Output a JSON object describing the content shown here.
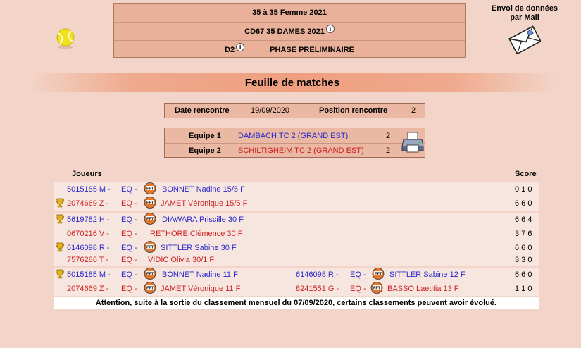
{
  "header": {
    "line1": "35  à 35  Femme  2021",
    "line2": "CD67 35 DAMES 2021",
    "line3_division": "D2",
    "line3_phase": "PHASE PRELIMINAIRE"
  },
  "mail": {
    "line1": "Envoi de données",
    "line2": "par Mail",
    "icon": "envelope-icon"
  },
  "section_title": "Feuille de matches",
  "rencontre": {
    "date_label": "Date rencontre",
    "date_value": "19/09/2020",
    "position_label": "Position rencontre",
    "position_value": "2"
  },
  "teams": [
    {
      "label": "Equipe 1",
      "name": "DAMBACH TC 2 (GRAND EST)",
      "score": "2"
    },
    {
      "label": "Equipe 2",
      "name": "SCHILTIGHEIM TC 2 (GRAND EST)",
      "score": "2"
    }
  ],
  "table": {
    "players_header": "Joueurs",
    "score_header": "Score"
  },
  "matches": [
    {
      "rows": [
        {
          "id": "5015185 M -",
          "eq": "EQ -",
          "fft": true,
          "name": "BONNET  Nadine  15/5 F",
          "score": "0 1 0",
          "trophy": false
        },
        {
          "id": "2074669 Z -",
          "eq": "EQ -",
          "fft": true,
          "name": "JAMET  Véronique  15/5 F",
          "score": "6 6 0",
          "trophy": true
        }
      ]
    },
    {
      "rows": [
        {
          "id": "5619782 H -",
          "eq": "EQ -",
          "fft": true,
          "name": "DIAWARA  Priscille  30 F",
          "score": "6 6 4",
          "trophy": true
        },
        {
          "id": "0670216 V -",
          "eq": "EQ -",
          "fft": false,
          "name": "RETHORE  Clémence  30 F",
          "score": "3 7 6",
          "trophy": false
        }
      ]
    },
    {
      "rows": [
        {
          "id": "6146098 R -",
          "eq": "EQ -",
          "fft": true,
          "name": "SITTLER  Sabine  30 F",
          "score": "6 6 0",
          "trophy": true
        },
        {
          "id": "7576286 T -",
          "eq": "EQ -",
          "fft": false,
          "name": "VIDIC  Olivia 30/1 F",
          "score": "3 3 0",
          "trophy": false
        }
      ]
    },
    {
      "rows": [
        {
          "id": "5015185 M -",
          "eq": "EQ -",
          "fft": true,
          "name": "BONNET  Nadine  11 F",
          "id2": "6146098 R -",
          "eq2": "EQ -",
          "name2": "SITTLER  Sabine  12 F",
          "score": "6 6 0",
          "trophy": true
        },
        {
          "id": "2074669 Z -",
          "eq": "EQ -",
          "fft": true,
          "name": "JAMET  Véronique  11 F",
          "id2": "8241551 G -",
          "eq2": "EQ -",
          "name2": "BASSO  Laetitia  13 F",
          "score": "1 1 0",
          "trophy": false
        }
      ]
    }
  ],
  "warning": "Attention, suite à la sortie du classement mensuel du 07/09/2020, certains classements peuvent avoir évolué."
}
